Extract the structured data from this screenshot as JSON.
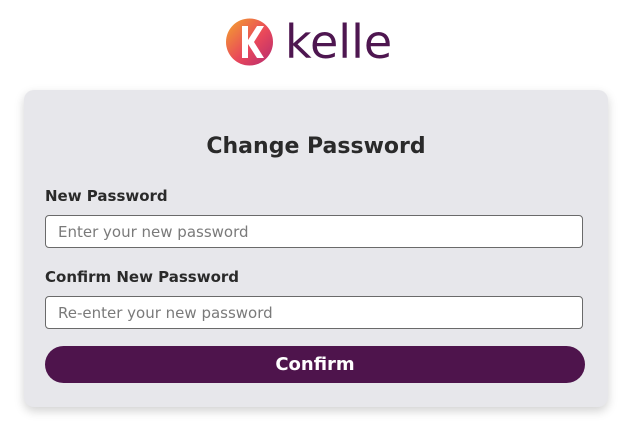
{
  "brand": {
    "name": "kelle",
    "logo_icon": "kelle-k-logo-icon",
    "colors": {
      "text": "#4e1650",
      "gradient_start": "#f0a030",
      "gradient_mid": "#e8455a",
      "gradient_end": "#b52a6e"
    }
  },
  "form": {
    "title": "Change Password",
    "new_password": {
      "label": "New Password",
      "placeholder": "Enter your new password",
      "value": ""
    },
    "confirm_password": {
      "label": "Confirm New Password",
      "placeholder": "Re-enter your new password",
      "value": ""
    },
    "submit_label": "Confirm",
    "accent_color": "#4e144c"
  }
}
